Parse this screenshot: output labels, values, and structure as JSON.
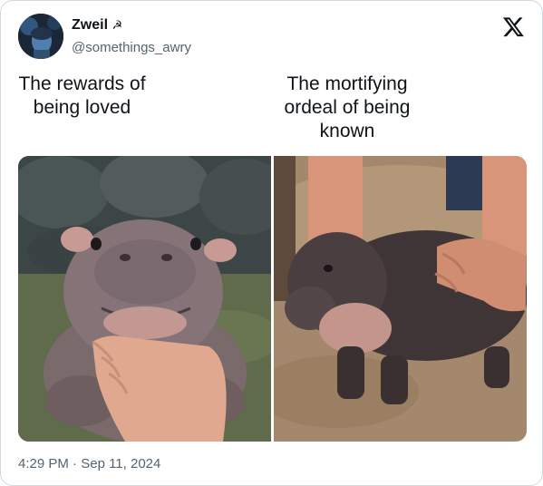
{
  "author": {
    "display_name": "Zweil",
    "name_emoji": "☭",
    "handle": "@somethings_awry",
    "avatar_icon": "avatar-photo"
  },
  "platform_icon": "x-logo-icon",
  "captions": {
    "left": "The rewards of being loved",
    "right": "The mortifying ordeal of being known"
  },
  "images": [
    {
      "icon": "hippo-photo-smiling",
      "alt_hint": "baby pygmy hippo smiling while chin held by hand"
    },
    {
      "icon": "hippo-photo-walking",
      "alt_hint": "baby pygmy hippo being held by hands while walking"
    }
  ],
  "meta": {
    "time": "4:29 PM",
    "separator": "·",
    "date": "Sep 11, 2024"
  },
  "colors": {
    "text_primary": "#0f1419",
    "text_secondary": "#536471",
    "border": "#cfd9de"
  }
}
